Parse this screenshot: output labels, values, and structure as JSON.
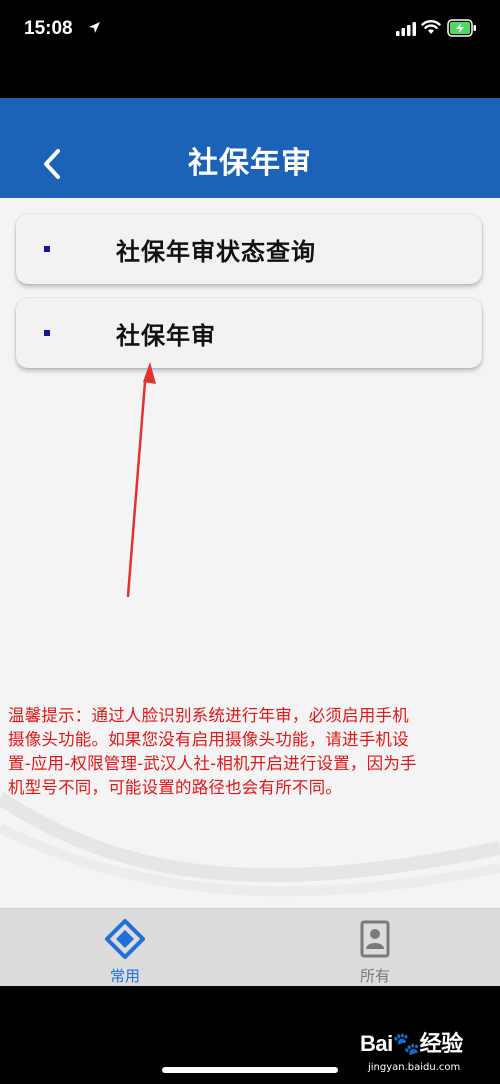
{
  "status_bar": {
    "time": "15:08"
  },
  "header": {
    "title": "社保年审"
  },
  "menu": {
    "items": [
      {
        "label": "社保年审状态查询"
      },
      {
        "label": "社保年审"
      }
    ]
  },
  "notice": {
    "line1": "温馨提示：通过人脸识别系统进行年审，必须启用手机",
    "line2": "摄像头功能。如果您没有启用摄像头功能，请进手机设",
    "line3": "置-应用-权限管理-武汉人社-相机开启进行设置，因为手",
    "line4": "机型号不同，可能设置的路径也会有所不同。"
  },
  "tab_bar": {
    "tabs": [
      {
        "label": "常用",
        "icon": "diamond-icon",
        "active": true
      },
      {
        "label": "所有",
        "icon": "profile-card-icon",
        "active": false
      }
    ]
  },
  "watermark": {
    "brand": "Bai🐾经验",
    "url": "jingyan.baidu.com"
  },
  "colors": {
    "header": "#1a63b7",
    "notice": "#e01818",
    "active_tab": "#2170d8",
    "arrow": "#e53030"
  }
}
